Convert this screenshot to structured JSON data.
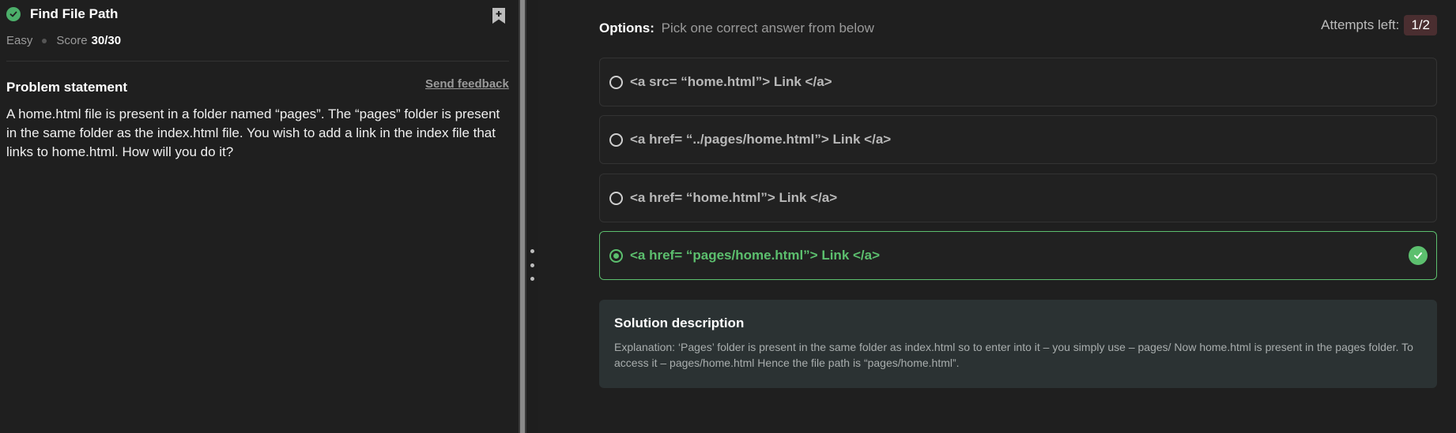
{
  "problem": {
    "title": "Find File Path",
    "difficulty": "Easy",
    "score_label": "Score",
    "score_value": "30/30",
    "statement_heading": "Problem statement",
    "feedback_link": "Send feedback",
    "statement": "A home.html file is present in a folder named “pages”. The “pages” folder is present in the same folder as the index.html file. You wish to add a link in the index file that links to home.html. How will you do it?"
  },
  "options_header": {
    "label": "Options:",
    "hint": "Pick one correct answer from below"
  },
  "attempts": {
    "label": "Attempts left:",
    "value": "1/2"
  },
  "options": [
    {
      "text": "<a src= “home.html”> Link </a>",
      "state": "unselected"
    },
    {
      "text": "<a href= “../pages/home.html”> Link </a>",
      "state": "unselected"
    },
    {
      "text": "<a href= “home.html”> Link </a>",
      "state": "unselected"
    },
    {
      "text": "<a href= “pages/home.html”> Link </a>",
      "state": "correct"
    }
  ],
  "solution": {
    "title": "Solution description",
    "body": "Explanation: ‘Pages’ folder is present in the same folder as index.html so to enter into it – you simply use – pages/ Now home.html is present in the pages folder. To access it – pages/home.html Hence the file path is “pages/home.html”."
  },
  "colors": {
    "success": "#5cbf6e",
    "background": "#1f1f1f",
    "attempts_badge": "#4a2e30",
    "solution_bg": "#2b3233"
  },
  "icons": [
    "check-circle-icon",
    "bookmark-add-icon",
    "radio-icon",
    "drag-grip-icon"
  ]
}
